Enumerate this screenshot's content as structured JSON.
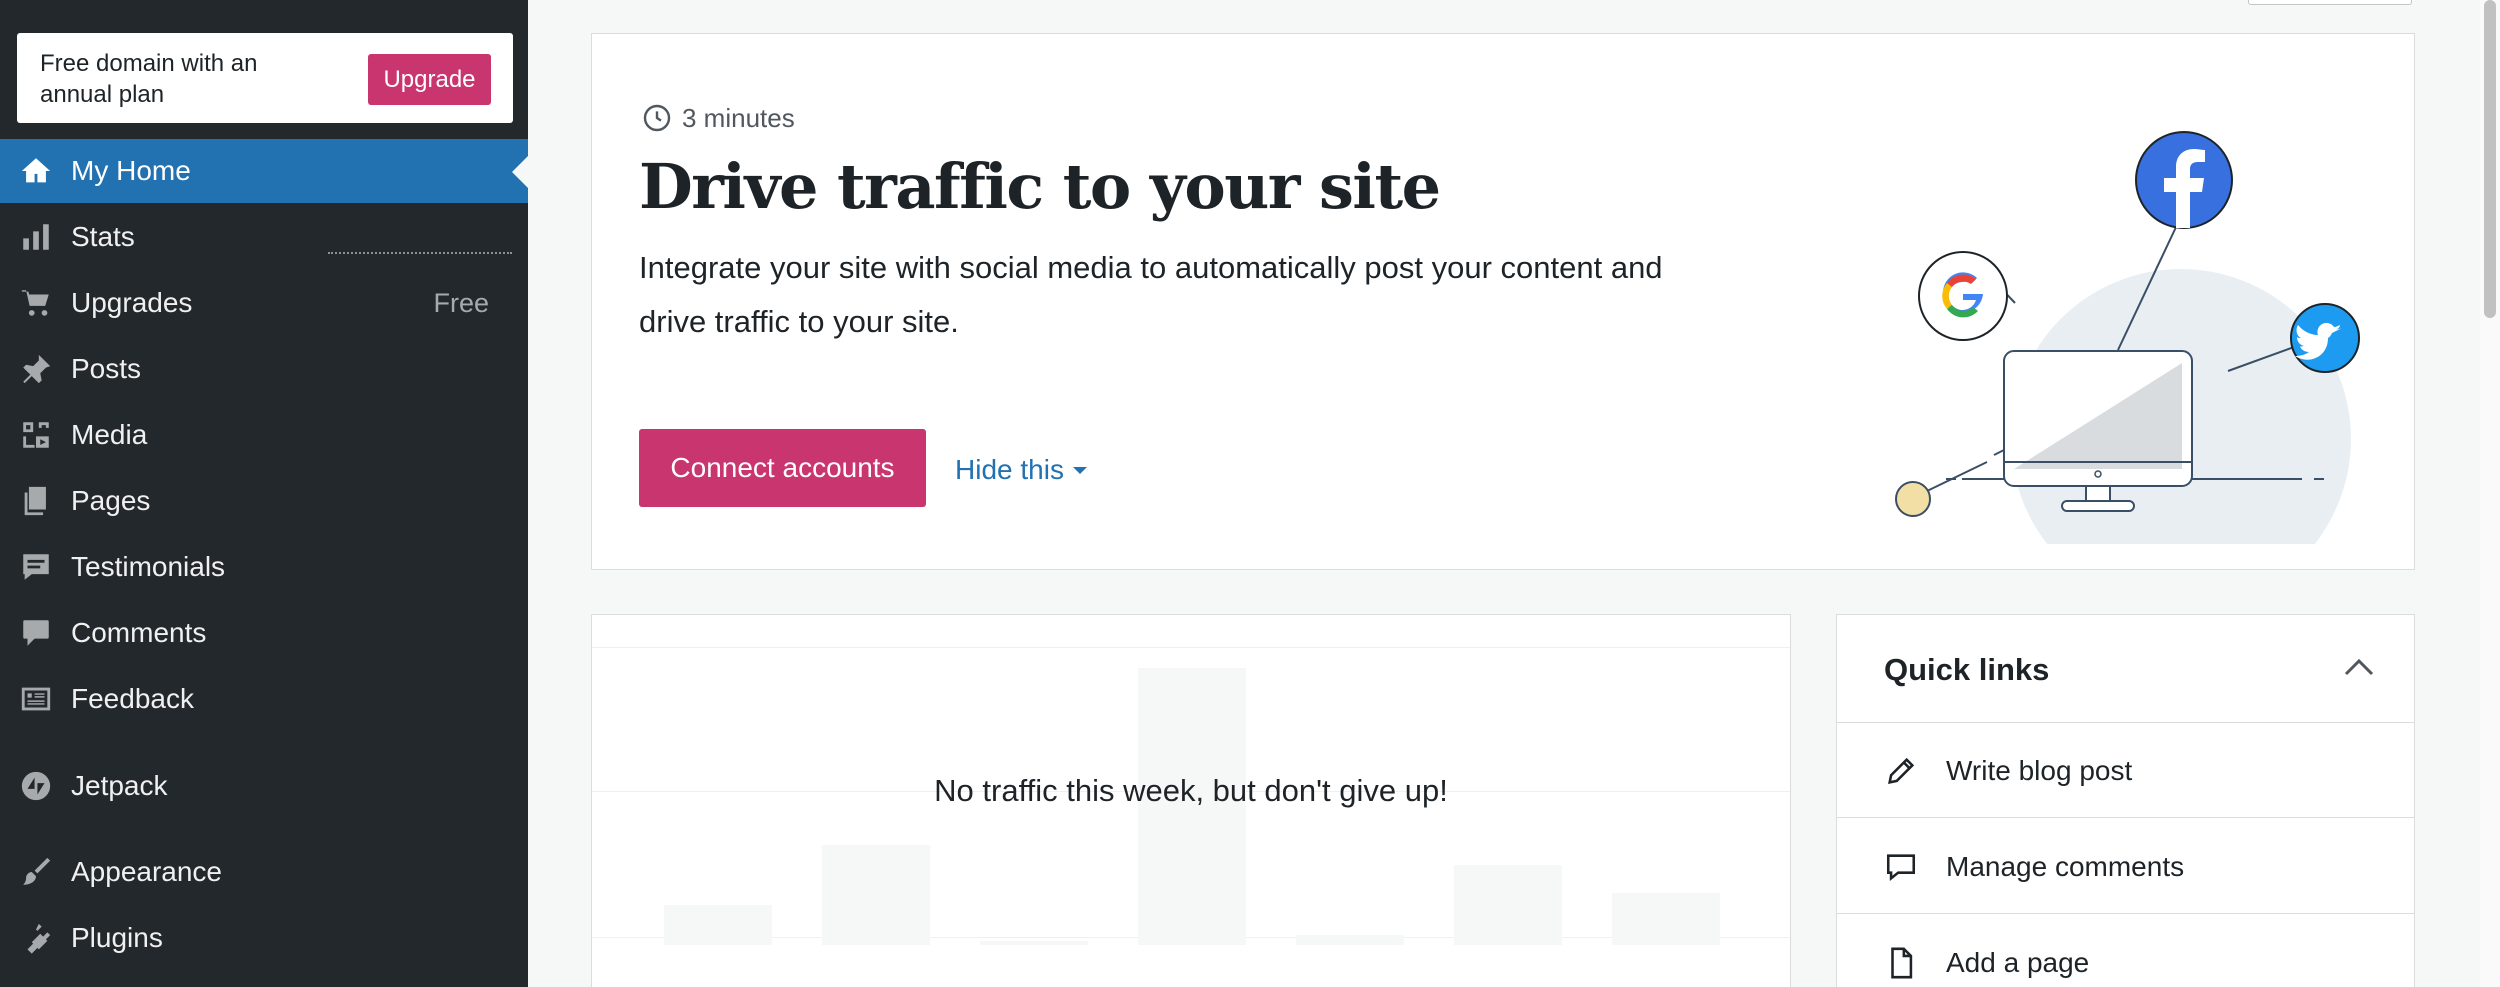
{
  "upsell": {
    "text": "Free domain with an annual plan",
    "button": "Upgrade"
  },
  "sidebar": {
    "items": [
      {
        "label": "My Home",
        "icon": "home-icon",
        "active": true
      },
      {
        "label": "Stats",
        "icon": "stats-icon"
      },
      {
        "label": "Upgrades",
        "icon": "cart-icon",
        "badge": "Free"
      },
      {
        "label": "Posts",
        "icon": "pin-icon"
      },
      {
        "label": "Media",
        "icon": "media-icon"
      },
      {
        "label": "Pages",
        "icon": "pages-icon"
      },
      {
        "label": "Testimonials",
        "icon": "testimonial-icon"
      },
      {
        "label": "Comments",
        "icon": "comment-icon"
      },
      {
        "label": "Feedback",
        "icon": "feedback-icon"
      },
      {
        "label": "Jetpack",
        "icon": "jetpack-icon"
      },
      {
        "label": "Appearance",
        "icon": "brush-icon"
      },
      {
        "label": "Plugins",
        "icon": "plugin-icon"
      }
    ]
  },
  "task": {
    "timing": "3 minutes",
    "title": "Drive traffic to your site",
    "description": "Integrate your site with social media to automatically post your content and drive traffic to your site.",
    "primary_button": "Connect accounts",
    "secondary_link": "Hide this"
  },
  "stats": {
    "empty_message": "No traffic this week, but don't give up!"
  },
  "quick_links": {
    "title": "Quick links",
    "items": [
      {
        "label": "Write blog post",
        "icon": "pencil-icon"
      },
      {
        "label": "Manage comments",
        "icon": "comment-outline-icon"
      },
      {
        "label": "Add a page",
        "icon": "page-icon"
      }
    ]
  },
  "colors": {
    "sidebar_bg": "#23282d",
    "active_blue": "#2271b1",
    "accent_pink": "#c9356e",
    "page_bg": "#f6f7f7"
  }
}
